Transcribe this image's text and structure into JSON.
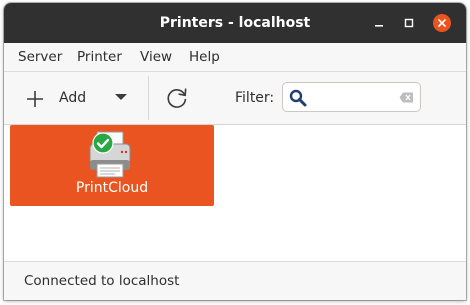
{
  "window": {
    "title": "Printers - localhost"
  },
  "menu": {
    "items": [
      "Server",
      "Printer",
      "View",
      "Help"
    ]
  },
  "toolbar": {
    "add_label": "Add",
    "filter_label": "Filter:",
    "filter_value": "",
    "icons": [
      "plus-icon",
      "chevron-down-icon",
      "refresh-icon",
      "search-icon",
      "clear-icon"
    ]
  },
  "printers": [
    {
      "name": "PrintCloud",
      "status_icon": "check-circle-icon"
    }
  ],
  "status": {
    "text": "Connected to localhost"
  },
  "colors": {
    "titlebar": "#303030",
    "accent": "#e95420",
    "success": "#28a745"
  }
}
